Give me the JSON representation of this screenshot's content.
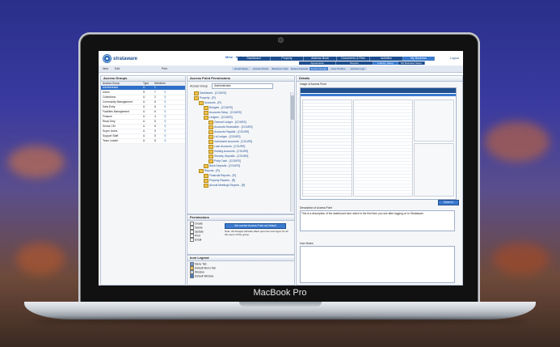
{
  "device": {
    "brand_label": "MacBook Pro"
  },
  "app": {
    "logo_text": "strataware",
    "user_links": "Mine · Help",
    "nav_tabs": [
      "Dashboard",
      "Property",
      "Address Book",
      "Documents & Files",
      "Activities",
      "My Business"
    ],
    "logout_label": "Logout",
    "sub_tabs": [
      "Agreements",
      "Reports",
      "Industry Setup",
      "My Business Setup"
    ],
    "toolbar": {
      "new": "New",
      "edit": "Edit",
      "print": "Print"
    },
    "lower_tabs": [
      "Email Setup",
      "Access Points",
      "Business Units",
      "System Defaults",
      "Access Groups",
      "User Profiles",
      "Access Logs"
    ],
    "access_groups": {
      "title": "Access Groups",
      "columns": [
        "Access Group",
        "Type",
        "Members"
      ],
      "rows": [
        {
          "name": "Administrator",
          "type": "U",
          "members": "1"
        },
        {
          "name": "Users",
          "type": "S",
          "members": "7"
        },
        {
          "name": "Collections",
          "type": "U",
          "members": "2"
        },
        {
          "name": "Community Management",
          "type": "U",
          "members": "6"
        },
        {
          "name": "Data Entry",
          "type": "U",
          "members": "6"
        },
        {
          "name": "Facilities Management",
          "type": "U",
          "members": "6"
        },
        {
          "name": "Finance",
          "type": "U",
          "members": "4"
        },
        {
          "name": "Read Only",
          "type": "U",
          "members": "5"
        },
        {
          "name": "Senior CM",
          "type": "U",
          "members": "6"
        },
        {
          "name": "Super Users",
          "type": "U",
          "members": "9"
        },
        {
          "name": "Support Staff",
          "type": "U",
          "members": "5"
        },
        {
          "name": "Team Leader",
          "type": "U",
          "members": "5"
        }
      ]
    },
    "access_point_permissions": {
      "title": "Access Point Permissions",
      "group_label": "Access Group",
      "group_value": "Administrator",
      "tree": [
        "Dashboard - [COURS]",
        "Property - [R]",
        "Accounts - [R]",
        "Budgets - [COURS]",
        "Accounts Setup - [COURS]",
        "Ledgers - [COURS]",
        "General Ledger - [COURS]",
        "Accounts Receivable - [COURS]",
        "Accounts Payable - [COURS]",
        "Lot Ledger - [COURS]",
        "Investment Accounts - [COURS]",
        "Loan Accounts - [COURS]",
        "Holding Accounts - [COURS]",
        "Security Deposits - [COURS]",
        "Petty Cash - [COURS]",
        "Bank Deposits - [COURS]",
        "Reports - [R]",
        "Financial Reports - [R]",
        "Property Reports - [R]",
        "Annual Meetings Reports - [R]"
      ]
    },
    "permissions": {
      "title": "Permissions",
      "checks": [
        "Create",
        "Delete",
        "Update",
        "Print",
        "Email"
      ],
      "button_label": "Set current Access Point as Default",
      "note": "Note: All changes will take effect upon the next logon for all the users of this group."
    },
    "icon_legend": {
      "title": "Icon Legend",
      "items": [
        "Menu Tab",
        "Default Menu Tab",
        "Window",
        "Default Window"
      ]
    },
    "details": {
      "title": "Details",
      "image_label": "Image of Access Point",
      "zoom_button": "Zoom In",
      "description_label": "Description of Access Point",
      "description_text": "This is a description of the dashboard form which is the first form you see after logging on to Strataware.",
      "user_notes_label": "User Notes"
    }
  },
  "colors": {
    "nav_blue": "#1f4f8f",
    "accent_blue": "#3b7bd0",
    "selection_blue": "#2e6fc9"
  }
}
